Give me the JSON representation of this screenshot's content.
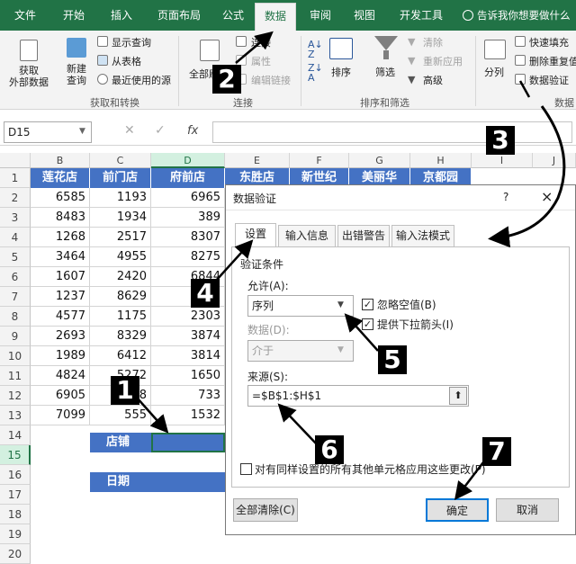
{
  "ribbon_tabs": [
    {
      "label": "文件"
    },
    {
      "label": "开始"
    },
    {
      "label": "插入"
    },
    {
      "label": "页面布局"
    },
    {
      "label": "公式"
    },
    {
      "label": "数据"
    },
    {
      "label": "审阅"
    },
    {
      "label": "视图"
    },
    {
      "label": "开发工具"
    }
  ],
  "tell_me": "告诉我你想要做什么",
  "ribbon": {
    "get_external": "获取\n外部数据",
    "new_query": "新建\n查询",
    "show_query": "显示查询",
    "from_table": "从表格",
    "recent_source": "最近使用的源",
    "group_get": "获取和转换",
    "refresh_all": "全部刷新",
    "connections": "连接",
    "properties": "属性",
    "edit_links": "编辑链接",
    "group_conn": "连接",
    "sort": "排序",
    "filter": "筛选",
    "clear": "清除",
    "reapply": "重新应用",
    "advanced": "高级",
    "group_sort": "排序和筛选",
    "split": "分列",
    "flash_fill": "快速填充",
    "remove_dup": "删除重复值",
    "data_validation": "数据验证",
    "group_tools": "数据"
  },
  "name_box": "D15",
  "formula_fx": "fx",
  "columns": [
    "B",
    "C",
    "D",
    "E",
    "F",
    "G",
    "H",
    "I",
    "J"
  ],
  "rows": [
    "1",
    "2",
    "3",
    "4",
    "5",
    "6",
    "7",
    "8",
    "9",
    "10",
    "11",
    "12",
    "13",
    "14",
    "15",
    "16",
    "17",
    "18",
    "19",
    "20"
  ],
  "header_row": [
    "莲花店",
    "前门店",
    "府前店",
    "东胜店",
    "新世纪",
    "美丽华",
    "京都园"
  ],
  "table": [
    [
      "6585",
      "1193",
      "6965"
    ],
    [
      "8483",
      "1934",
      "389"
    ],
    [
      "1268",
      "2517",
      "8307"
    ],
    [
      "3464",
      "4955",
      "8275"
    ],
    [
      "1607",
      "2420",
      "6844"
    ],
    [
      "1237",
      "8629",
      "7"
    ],
    [
      "4577",
      "1175",
      "2303"
    ],
    [
      "2693",
      "8329",
      "3874"
    ],
    [
      "1989",
      "6412",
      "3814"
    ],
    [
      "4824",
      "5272",
      "1650"
    ],
    [
      "6905",
      "78",
      "733"
    ],
    [
      "7099",
      "555",
      "1532"
    ]
  ],
  "store_label": "店铺",
  "date_label": "日期",
  "dialog": {
    "title": "数据验证",
    "help": "?",
    "close": "×",
    "tabs": [
      "设置",
      "输入信息",
      "出错警告",
      "输入法模式"
    ],
    "criteria": "验证条件",
    "allow_label": "允许(A):",
    "allow_value": "序列",
    "ignore_blank": "忽略空值(B)",
    "dropdown": "提供下拉箭头(I)",
    "data_label": "数据(D):",
    "data_value": "介于",
    "source_label": "来源(S):",
    "source_value": "=$B$1:$H$1",
    "apply_all": "对有同样设置的所有其他单元格应用这些更改(P)",
    "clear_all": "全部清除(C)",
    "ok": "确定",
    "cancel": "取消"
  },
  "steps": [
    "1",
    "2",
    "3",
    "4",
    "5",
    "6",
    "7"
  ]
}
